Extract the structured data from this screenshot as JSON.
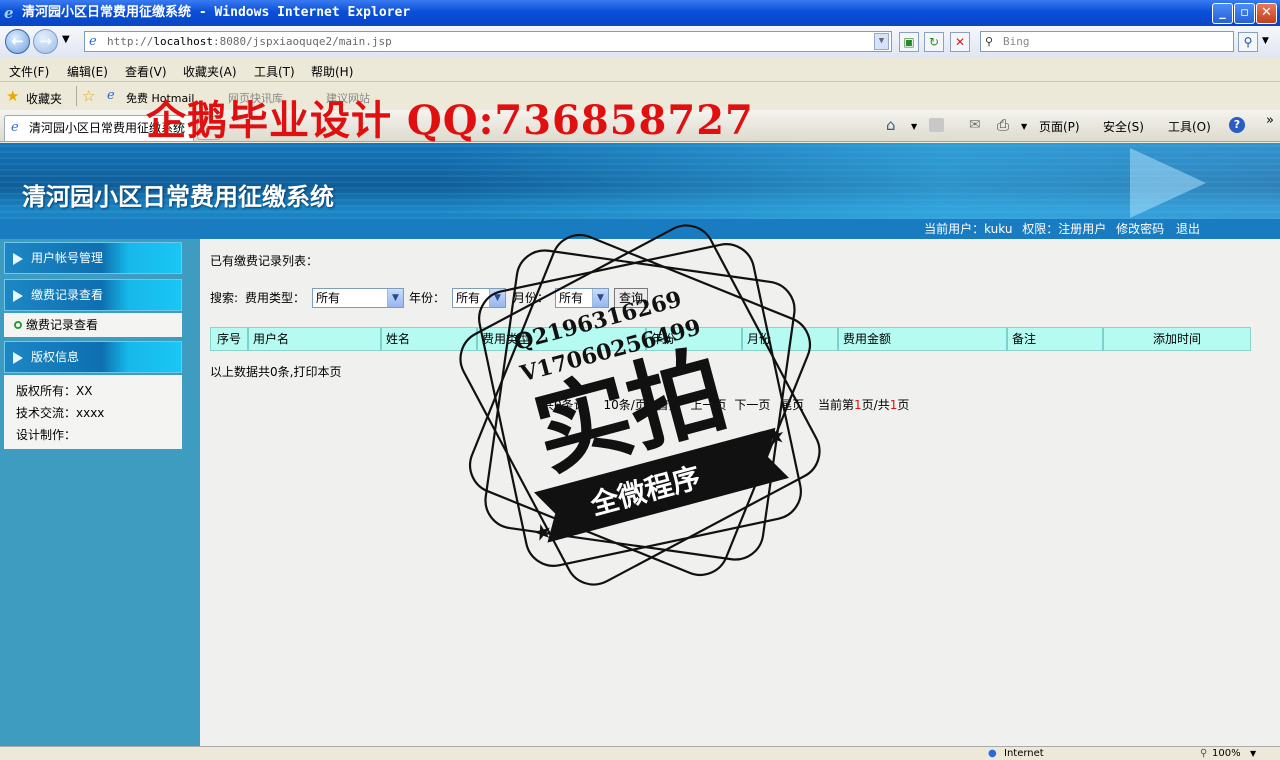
{
  "window": {
    "title": "清河园小区日常费用征缴系统 - Windows Internet Explorer",
    "min_symbol": "_",
    "max_symbol": "▫",
    "close_symbol": "✕"
  },
  "address": {
    "url_prefix": "http://",
    "url_host": "localhost",
    "url_rest": ":8080/jspxiaoquqe2/main.jsp",
    "search_placeholder": "Bing"
  },
  "menu": {
    "file": "文件(F)",
    "edit": "编辑(E)",
    "view": "查看(V)",
    "favorites": "收藏夹(A)",
    "tools": "工具(T)",
    "help": "帮助(H)"
  },
  "favbar": {
    "favorites_label": "收藏夹",
    "free_hotmail": "免费 Hotmail",
    "web_slice": "网页快讯库",
    "suggested_sites": "建议网站"
  },
  "tabs": {
    "active_tab": "清河园小区日常费用征缴系统"
  },
  "commandbar": {
    "page": "页面(P)",
    "safety": "安全(S)",
    "tools": "工具(O)"
  },
  "overlay": {
    "watermark": "企鹅毕业设计 QQ:736858727",
    "stamp_line1": "Q2196316269",
    "stamp_line2": "V17060256499",
    "stamp_main": "实拍",
    "stamp_ribbon": "全微程序"
  },
  "app": {
    "system_title": "清河园小区日常费用征缴系统",
    "current_user_label": "当前用户：",
    "current_user": "kuku",
    "role_label": "权限：",
    "role": "注册用户",
    "change_password": "修改密码",
    "logout": "退出"
  },
  "sidebar": {
    "sections": [
      {
        "label": "用户帐号管理"
      },
      {
        "label": "缴费记录查看"
      },
      {
        "label": "版权信息"
      }
    ],
    "subitem": "缴费记录查看",
    "info": {
      "copyright": "版权所有：XX",
      "tech": "技术交流：xxxx",
      "design": "设计制作："
    }
  },
  "main": {
    "list_title": "已有缴费记录列表：",
    "search_label": "搜索:",
    "fee_type_label": "费用类型：",
    "fee_type_value": "所有",
    "year_label": "年份：",
    "year_value": "所有",
    "month_label": "月份：",
    "month_value": "所有",
    "query_button": "查询",
    "columns": [
      "序号",
      "用户名",
      "姓名",
      "费用类型",
      "年份",
      "月份",
      "费用金额",
      "备注",
      "添加时间"
    ],
    "summary": "以上数据共0条,打印本页",
    "pager": {
      "total": "共0条记",
      "per_page": "10条/页",
      "first": "首页",
      "prev": "上一页",
      "next": "下一页",
      "last": "尾页",
      "current_label": "当前第",
      "current": "1",
      "page_unit": "页/共",
      "total_pages": "1",
      "page_suffix": "页"
    }
  },
  "statusbar": {
    "zone": "Internet",
    "zoom": "100%"
  }
}
